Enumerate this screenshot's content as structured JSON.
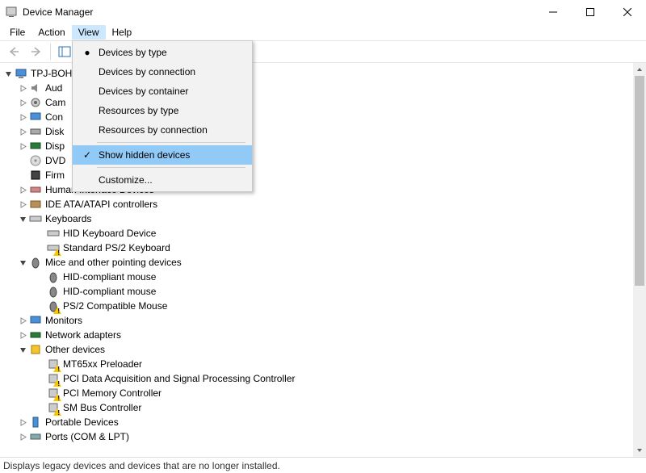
{
  "window": {
    "title": "Device Manager"
  },
  "menu": {
    "file": "File",
    "action": "Action",
    "view": "View",
    "help": "Help"
  },
  "view_menu": {
    "devices_by_type": "Devices by type",
    "devices_by_connection": "Devices by connection",
    "devices_by_container": "Devices by container",
    "resources_by_type": "Resources by type",
    "resources_by_connection": "Resources by connection",
    "show_hidden": "Show hidden devices",
    "customize": "Customize..."
  },
  "tree": {
    "root": "TPJ-BOH",
    "audio": "Aud",
    "cameras": "Cam",
    "computer": "Con",
    "disk": "Disk",
    "display": "Disp",
    "dvd": "DVD",
    "firmware": "Firm",
    "hid": "Human Interface Devices",
    "ide": "IDE ATA/ATAPI controllers",
    "keyboards": "Keyboards",
    "hid_keyboard": "HID Keyboard Device",
    "ps2_keyboard": "Standard PS/2 Keyboard",
    "mice": "Mice and other pointing devices",
    "hid_mouse1": "HID-compliant mouse",
    "hid_mouse2": "HID-compliant mouse",
    "ps2_mouse": "PS/2 Compatible Mouse",
    "monitors": "Monitors",
    "network": "Network adapters",
    "other": "Other devices",
    "mt65xx": "MT65xx Preloader",
    "pci_data": "PCI Data Acquisition and Signal Processing Controller",
    "pci_mem": "PCI Memory Controller",
    "sm_bus": "SM Bus Controller",
    "portable": "Portable Devices",
    "ports": "Ports (COM & LPT)"
  },
  "status": {
    "text": "Displays legacy devices and devices that are no longer installed."
  }
}
